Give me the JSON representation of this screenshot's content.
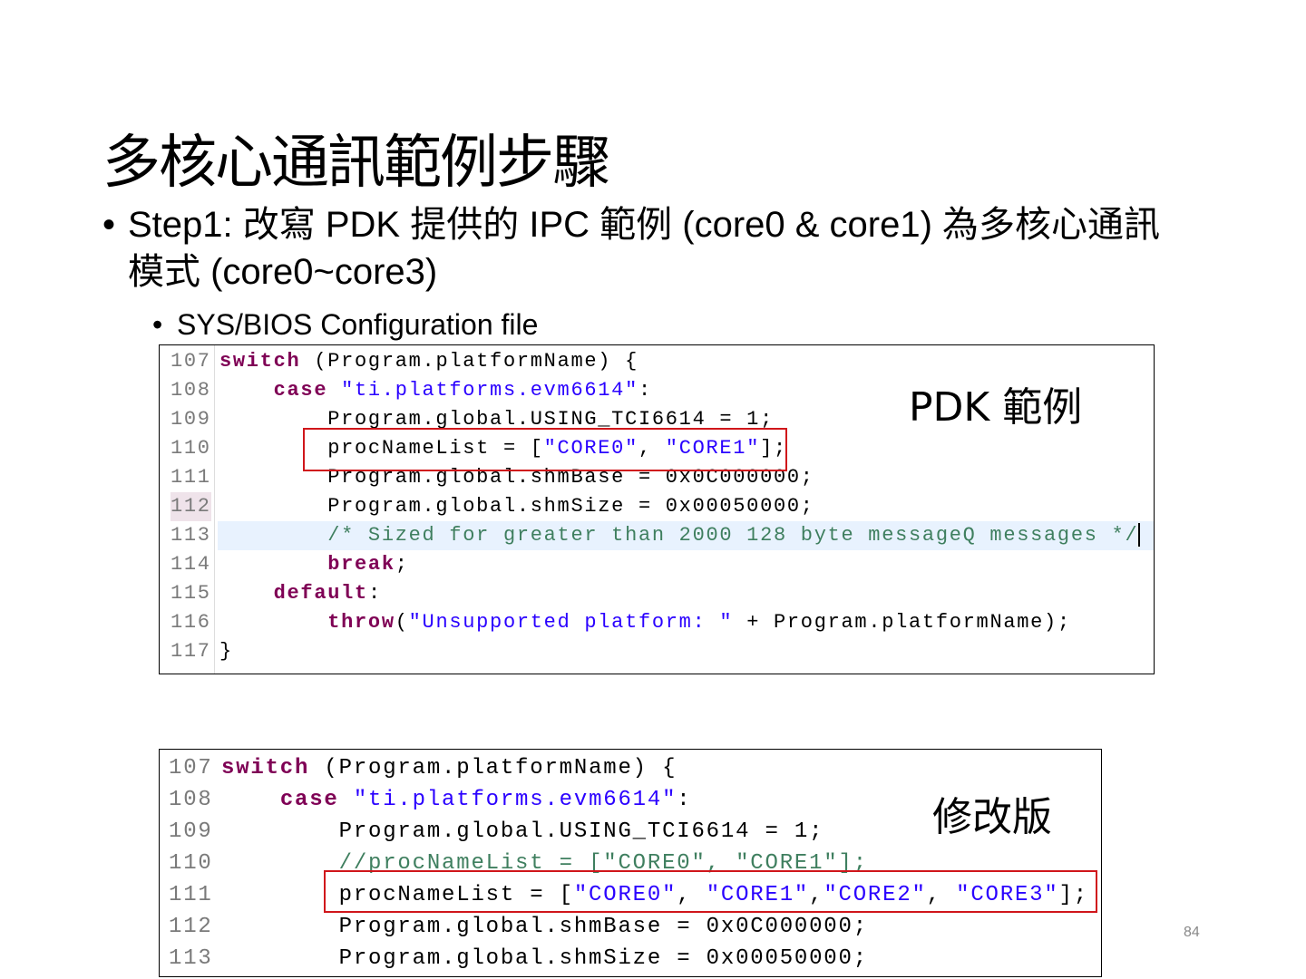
{
  "slide": {
    "title": "多核心通訊範例步驟",
    "bullet1": "Step1:  改寫 PDK 提供的 IPC 範例 (core0 & core1) 為多核心通訊模式 (core0~core3)",
    "bullet2": "SYS/BIOS Configuration file",
    "bullet_glyph": "•",
    "page_number": "84"
  },
  "code_original": {
    "label": "PDK 範例",
    "lines": [
      {
        "n": "107",
        "tokens": [
          [
            "kw",
            "switch"
          ],
          [
            "pl",
            " (Program.platformName) {"
          ]
        ]
      },
      {
        "n": "108",
        "tokens": [
          [
            "pl",
            "    "
          ],
          [
            "kw",
            "case"
          ],
          [
            "pl",
            " "
          ],
          [
            "str",
            "\"ti.platforms.evm6614\""
          ],
          [
            "pl",
            ":"
          ]
        ]
      },
      {
        "n": "109",
        "tokens": [
          [
            "pl",
            "        Program.global.USING_TCI6614 = 1;"
          ]
        ]
      },
      {
        "n": "110",
        "tokens": [
          [
            "pl",
            "        procNameList = ["
          ],
          [
            "str",
            "\"CORE0\""
          ],
          [
            "pl",
            ", "
          ],
          [
            "str",
            "\"CORE1\""
          ],
          [
            "pl",
            "];"
          ]
        ]
      },
      {
        "n": "111",
        "tokens": [
          [
            "pl",
            "        Program.global.shmBase = 0x0C000000;"
          ]
        ]
      },
      {
        "n": "112",
        "tokens": [
          [
            "pl",
            "        Program.global.shmSize = 0x00050000;"
          ]
        ]
      },
      {
        "n": "113",
        "tokens": [
          [
            "pl",
            "        "
          ],
          [
            "cm",
            "/* Sized for greater than 2000 128 byte messageQ messages */"
          ]
        ]
      },
      {
        "n": "114",
        "tokens": [
          [
            "pl",
            "        "
          ],
          [
            "kw",
            "break"
          ],
          [
            "pl",
            ";"
          ]
        ]
      },
      {
        "n": "115",
        "tokens": [
          [
            "pl",
            "    "
          ],
          [
            "kw",
            "default"
          ],
          [
            "pl",
            ":"
          ]
        ]
      },
      {
        "n": "116",
        "tokens": [
          [
            "pl",
            "        "
          ],
          [
            "kw",
            "throw"
          ],
          [
            "pl",
            "("
          ],
          [
            "str",
            "\"Unsupported platform: \""
          ],
          [
            "pl",
            " + Program.platformName);"
          ]
        ]
      },
      {
        "n": "117",
        "tokens": [
          [
            "pl",
            "}"
          ]
        ]
      }
    ]
  },
  "code_modified": {
    "label": "修改版",
    "lines": [
      {
        "n": "107",
        "tokens": [
          [
            "kw",
            "switch"
          ],
          [
            "pl",
            " (Program.platformName) {"
          ]
        ]
      },
      {
        "n": "108",
        "tokens": [
          [
            "pl",
            "    "
          ],
          [
            "kw",
            "case"
          ],
          [
            "pl",
            " "
          ],
          [
            "str",
            "\"ti.platforms.evm6614\""
          ],
          [
            "pl",
            ":"
          ]
        ]
      },
      {
        "n": "109",
        "tokens": [
          [
            "pl",
            "        Program.global.USING_TCI6614 = 1;"
          ]
        ]
      },
      {
        "n": "110",
        "tokens": [
          [
            "pl",
            "        "
          ],
          [
            "cm",
            "//procNameList = [\"CORE0\", \"CORE1\"];"
          ]
        ]
      },
      {
        "n": "111",
        "tokens": [
          [
            "pl",
            "        procNameList = ["
          ],
          [
            "str",
            "\"CORE0\""
          ],
          [
            "pl",
            ", "
          ],
          [
            "str",
            "\"CORE1\""
          ],
          [
            "pl",
            ","
          ],
          [
            "str",
            "\"CORE2\""
          ],
          [
            "pl",
            ", "
          ],
          [
            "str",
            "\"CORE3\""
          ],
          [
            "pl",
            "];"
          ]
        ]
      },
      {
        "n": "112",
        "tokens": [
          [
            "pl",
            "        Program.global.shmBase = 0x0C000000;"
          ]
        ]
      },
      {
        "n": "113",
        "tokens": [
          [
            "pl",
            "        Program.global.shmSize = 0x00050000;"
          ]
        ]
      }
    ]
  },
  "colors": {
    "keyword": "#7f0055",
    "string": "#2a00ff",
    "comment": "#3f7f5f",
    "highlight_box": "#d0161b"
  }
}
